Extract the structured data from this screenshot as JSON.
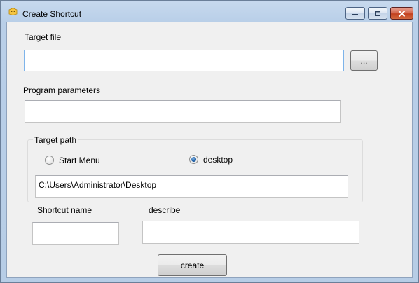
{
  "window": {
    "title": "Create Shortcut",
    "icons": {
      "app": "app-icon",
      "minimize": "minimize-icon",
      "maximize": "maximize-icon",
      "close": "close-icon"
    }
  },
  "target_file": {
    "label": "Target file",
    "value": "",
    "browse_label": "..."
  },
  "program_parameters": {
    "label": "Program parameters",
    "value": ""
  },
  "target_path": {
    "group_label": "Target path",
    "options": [
      {
        "label": "Start Menu",
        "selected": false
      },
      {
        "label": "desktop",
        "selected": true
      }
    ],
    "path_value": "C:\\Users\\Administrator\\Desktop"
  },
  "shortcut_name": {
    "label": "Shortcut name",
    "value": ""
  },
  "describe": {
    "label": "describe",
    "value": ""
  },
  "create_button": "create",
  "colors": {
    "titlebar": "#b9cfe8",
    "client": "#f0f0f0",
    "close_button": "#c2401f",
    "focus_border": "#7eb4ea",
    "radio_dot": "#1d5fa8"
  }
}
